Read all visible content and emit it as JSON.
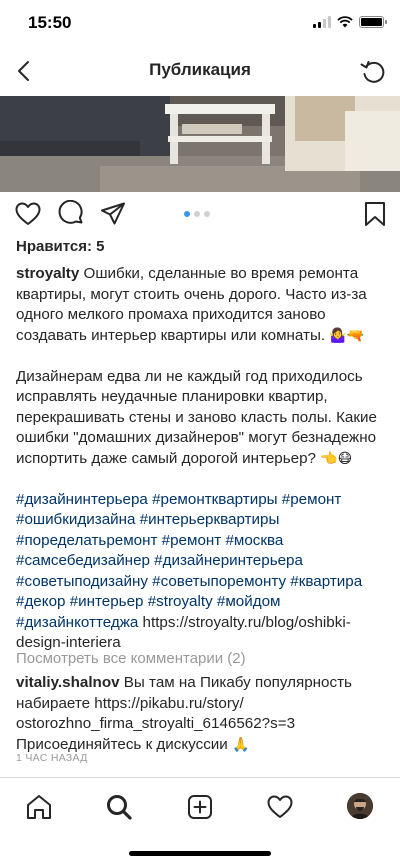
{
  "status_bar": {
    "time": "15:50"
  },
  "nav": {
    "title": "Публикация",
    "back_icon": "chevron-left-icon",
    "refresh_icon": "refresh-icon"
  },
  "post": {
    "likes": "Нравится: 5",
    "carousel": {
      "count": 3,
      "active": 1
    },
    "caption": {
      "username": "stroyalty",
      "paragraph1": " Ошибки, сделанные во время ремонта квартиры, могут стоить очень дорого. Часто из-за одного мелкого промаха приходится заново создавать интерьер квартиры или комнаты. ",
      "paragraph1_emoji": "🤷‍♀️🔫",
      "paragraph2": "Дизайнерам едва ли не каждый год приходилось исправлять неудачные планировки квартир, перекрашивать стены и заново класть полы. Какие ошибки \"домашних дизайнеров\" могут безнадежно испортить даже самый дорогой интерьер? ",
      "paragraph2_emoji": "👈😷",
      "hashtags": "#дизайнинтерьера #ремонтквартиры #ремонт #ошибкидизайна #интерьерквартиры #поределатьремонт #ремонт #москва #самсебедизайнер #дизайнеринтерьера #советыподизайну #советыпоремонту #квартира #декор #интерьер #stroyalty #мойдом #дизайнкоттеджа",
      "link": " https://stroyalty.ru/blog/oshibki-design-interiera"
    },
    "view_all_comments": "Посмотреть все комментарии (2)",
    "comment": {
      "username": "vitaliy.shalnov",
      "text": " Вы там на Пикабу популярность набираете https://pikabu.ru/story/ ostorozhno_firma_stroyalti_6146562?s=3 Присоединяйтесь к дискуссии ",
      "emoji": "🙏"
    },
    "time_ago": "1 ЧАС НАЗАД"
  },
  "colors": {
    "text": "#262626",
    "hashtag": "#003569",
    "secondary": "#999999",
    "carousel_active": "#3897f0"
  },
  "tab_bar": {
    "icons": [
      "home-icon",
      "search-icon",
      "add-post-icon",
      "heart-icon",
      "profile-avatar"
    ],
    "active": "search-icon"
  }
}
